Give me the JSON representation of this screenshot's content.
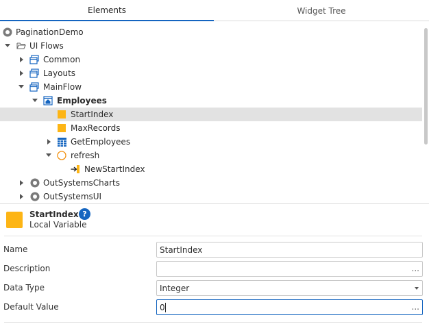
{
  "tabs": {
    "elements": "Elements",
    "widget_tree": "Widget Tree"
  },
  "tree": {
    "items": [
      {
        "label": "PaginationDemo",
        "icon": "module-icon"
      },
      {
        "label": "UI Flows",
        "icon": "folder-open-icon"
      },
      {
        "label": "Common",
        "icon": "flow-icon"
      },
      {
        "label": "Layouts",
        "icon": "flow-icon"
      },
      {
        "label": "MainFlow",
        "icon": "flow-icon"
      },
      {
        "label": "Employees",
        "icon": "screen-home-icon"
      },
      {
        "label": "StartIndex",
        "icon": "local-variable-icon"
      },
      {
        "label": "MaxRecords",
        "icon": "local-variable-icon"
      },
      {
        "label": "GetEmployees",
        "icon": "aggregate-icon"
      },
      {
        "label": "refresh",
        "icon": "action-circle-icon"
      },
      {
        "label": "NewStartIndex",
        "icon": "input-parameter-icon"
      },
      {
        "label": "OutSystemsCharts",
        "icon": "module-icon"
      },
      {
        "label": "OutSystemsUI",
        "icon": "module-icon"
      }
    ]
  },
  "properties": {
    "name": "StartIndex",
    "type": "Local Variable",
    "help": "?",
    "fields": [
      {
        "label": "Name",
        "value": "StartIndex"
      },
      {
        "label": "Description",
        "value": "",
        "button": "..."
      },
      {
        "label": "Data Type",
        "value": "Integer"
      },
      {
        "label": "Default Value",
        "value": "0",
        "button": "..."
      }
    ]
  },
  "colors": {
    "accent": "#1565c0",
    "variable": "#fdb515",
    "selected_row": "#e2e2e2"
  }
}
